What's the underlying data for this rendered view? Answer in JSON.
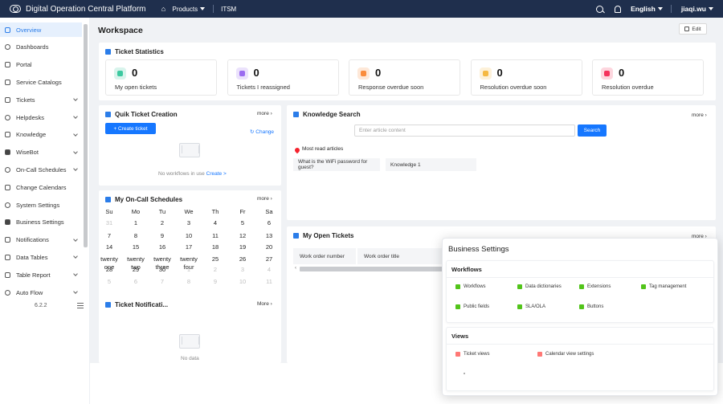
{
  "topbar": {
    "app_title": "Digital Operation Central Platform",
    "products_label": "Products",
    "itsm_label": "ITSM",
    "language": "English",
    "user": "jiaqi.wu"
  },
  "sidebar": {
    "items": [
      {
        "label": "Overview",
        "active": true,
        "expandable": false
      },
      {
        "label": "Dashboards",
        "active": false,
        "expandable": false
      },
      {
        "label": "Portal",
        "active": false,
        "expandable": false
      },
      {
        "label": "Service Catalogs",
        "active": false,
        "expandable": false
      },
      {
        "label": "Tickets",
        "active": false,
        "expandable": true
      },
      {
        "label": "Helpdesks",
        "active": false,
        "expandable": true
      },
      {
        "label": "Knowledge",
        "active": false,
        "expandable": true
      },
      {
        "label": "WiseBot",
        "active": false,
        "expandable": true
      },
      {
        "label": "On-Call Schedules",
        "active": false,
        "expandable": true
      },
      {
        "label": "Change Calendars",
        "active": false,
        "expandable": false
      },
      {
        "label": "System Settings",
        "active": false,
        "expandable": false
      },
      {
        "label": "Business Settings",
        "active": false,
        "expandable": false
      },
      {
        "label": "Notifications",
        "active": false,
        "expandable": true
      },
      {
        "label": "Data Tables",
        "active": false,
        "expandable": true
      },
      {
        "label": "Table Report",
        "active": false,
        "expandable": true
      },
      {
        "label": "Auto Flow",
        "active": false,
        "expandable": true
      }
    ],
    "version": "6.2.2"
  },
  "workspace": {
    "title": "Workspace",
    "edit_label": "Edit"
  },
  "ticket_statistics": {
    "title": "Ticket Statistics",
    "stats": [
      {
        "value": "0",
        "label": "My open tickets",
        "color": "#3cc9a0"
      },
      {
        "value": "0",
        "label": "Tickets I reassigned",
        "color": "#9b6cf0"
      },
      {
        "value": "0",
        "label": "Response overdue soon",
        "color": "#fa8c3c"
      },
      {
        "value": "0",
        "label": "Resolution overdue soon",
        "color": "#f5b942"
      },
      {
        "value": "0",
        "label": "Resolution overdue",
        "color": "#f5325c"
      }
    ]
  },
  "quick_ticket": {
    "title": "Quik Ticket Creation",
    "more": "more",
    "create_label": "+ Create ticket",
    "change_label": "Change",
    "empty_text": "No workflows in use",
    "empty_link": "Create >"
  },
  "knowledge": {
    "title": "Knowledge Search",
    "more": "more",
    "placeholder": "Enter article content",
    "search_label": "Search",
    "most_read_label": "Most read articles",
    "articles": [
      "What is the WiFi password for guest?",
      "Knowledge 1"
    ]
  },
  "oncall": {
    "title": "My On-Call Schedules",
    "more": "more",
    "weekdays": [
      "Su",
      "Mo",
      "Tu",
      "We",
      "Th",
      "Fr",
      "Sa"
    ],
    "weeks": [
      [
        {
          "d": "31",
          "m": true
        },
        {
          "d": "1"
        },
        {
          "d": "2"
        },
        {
          "d": "3"
        },
        {
          "d": "4"
        },
        {
          "d": "5"
        },
        {
          "d": "6"
        }
      ],
      [
        {
          "d": "7"
        },
        {
          "d": "8"
        },
        {
          "d": "9"
        },
        {
          "d": "10"
        },
        {
          "d": "11"
        },
        {
          "d": "12"
        },
        {
          "d": "13"
        }
      ],
      [
        {
          "d": "14"
        },
        {
          "d": "15"
        },
        {
          "d": "16"
        },
        {
          "d": "17"
        },
        {
          "d": "18"
        },
        {
          "d": "19"
        },
        {
          "d": "20"
        }
      ],
      [
        {
          "d": "twenty one"
        },
        {
          "d": "twenty two"
        },
        {
          "d": "twenty three"
        },
        {
          "d": "twenty four"
        },
        {
          "d": "25"
        },
        {
          "d": "26"
        },
        {
          "d": "27"
        }
      ],
      [
        {
          "d": "28"
        },
        {
          "d": "29"
        },
        {
          "d": "30"
        },
        {
          "d": "1",
          "m": true
        },
        {
          "d": "2",
          "m": true
        },
        {
          "d": "3",
          "m": true
        },
        {
          "d": "4",
          "m": true
        }
      ],
      [
        {
          "d": "5",
          "m": true
        },
        {
          "d": "6",
          "m": true
        },
        {
          "d": "7",
          "m": true
        },
        {
          "d": "8",
          "m": true
        },
        {
          "d": "9",
          "m": true
        },
        {
          "d": "10",
          "m": true
        },
        {
          "d": "11",
          "m": true
        }
      ]
    ]
  },
  "open_tickets": {
    "title": "My Open Tickets",
    "more": "more",
    "columns": [
      "Work order number",
      "Work order title"
    ]
  },
  "notifications": {
    "title": "Ticket Notificati...",
    "more": "More",
    "empty_text": "No data"
  },
  "business_settings": {
    "title": "Business Settings",
    "workflows": {
      "title": "Workflows",
      "items": [
        "Workflows",
        "Data dictionaries",
        "Extensions",
        "Tag management",
        "Public fields",
        "SLA/OLA",
        "Buttons"
      ]
    },
    "views": {
      "title": "Views",
      "items": [
        "Ticket views",
        "Calendar view settings"
      ]
    }
  }
}
